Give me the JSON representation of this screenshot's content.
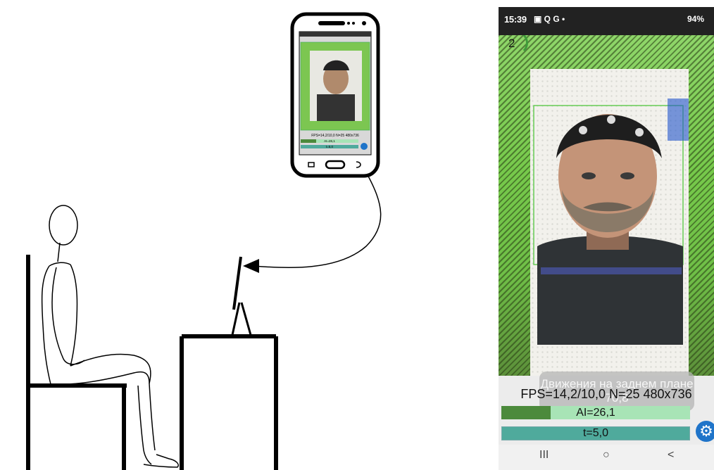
{
  "status_bar": {
    "time": "15:39",
    "left_icons": "▣ Q G •",
    "right_text": "94%"
  },
  "camera": {
    "counter": "2"
  },
  "overlay_message": "Движения на заднем плане 70,8",
  "fps_line": "FPS=14,2/10,0 N=25 480x736",
  "ai": {
    "label": "AI=26,1",
    "fill_fraction": 0.261
  },
  "t": {
    "label": "t=5,0"
  },
  "settings_icon": "gear-icon",
  "nav": {
    "recent": "III",
    "home": "○",
    "back": "<"
  },
  "phone_mini": {
    "fps_line": "FPS=14,2/10,0 N=25 480x736",
    "ai_label": "AI=26,1",
    "t_label": "t=5,0"
  },
  "colors": {
    "green": "#76c94b",
    "bar_teal": "#4faa9c",
    "settings_blue": "#1f74c9"
  }
}
